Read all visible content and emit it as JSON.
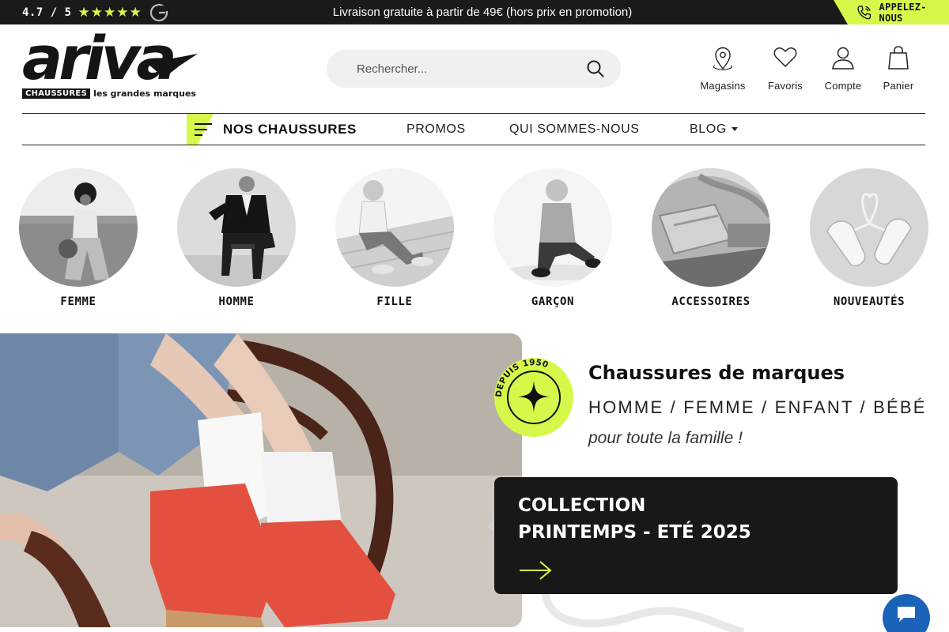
{
  "topbar": {
    "rating": "4.7 / 5",
    "stars": [
      "★",
      "★",
      "★",
      "★",
      "★"
    ],
    "promo": "Livraison gratuite à partir de 49€ (hors prix en promotion)",
    "call_label": "APPELEZ-NOUS",
    "accent_color": "#d6f84a"
  },
  "logo": {
    "word": "ariva",
    "chip": "CHAUSSURES",
    "tagline": "les grandes marques"
  },
  "search": {
    "placeholder": "Rechercher..."
  },
  "actions": [
    {
      "label": "Magasins",
      "icon": "map-pin-icon"
    },
    {
      "label": "Favoris",
      "icon": "heart-icon"
    },
    {
      "label": "Compte",
      "icon": "user-icon"
    },
    {
      "label": "Panier",
      "icon": "shopping-bag-icon"
    }
  ],
  "nav": {
    "items": [
      "NOS CHAUSSURES",
      "PROMOS",
      "QUI SOMMES-NOUS",
      "BLOG"
    ]
  },
  "categories": [
    {
      "label": "FEMME"
    },
    {
      "label": "HOMME"
    },
    {
      "label": "FILLE"
    },
    {
      "label": "GARÇON"
    },
    {
      "label": "ACCESSOIRES"
    },
    {
      "label": "NOUVEAUTÉS"
    }
  ],
  "hero": {
    "badge_text": "DEPUIS 1950",
    "title": "Chaussures de marques",
    "subtitle": "HOMME / FEMME / ENFANT / BÉBÉ",
    "tagline": "pour toute la famille !",
    "collection_line1": "COLLECTION",
    "collection_line2": "PRINTEMPS - ETÉ 2025"
  }
}
